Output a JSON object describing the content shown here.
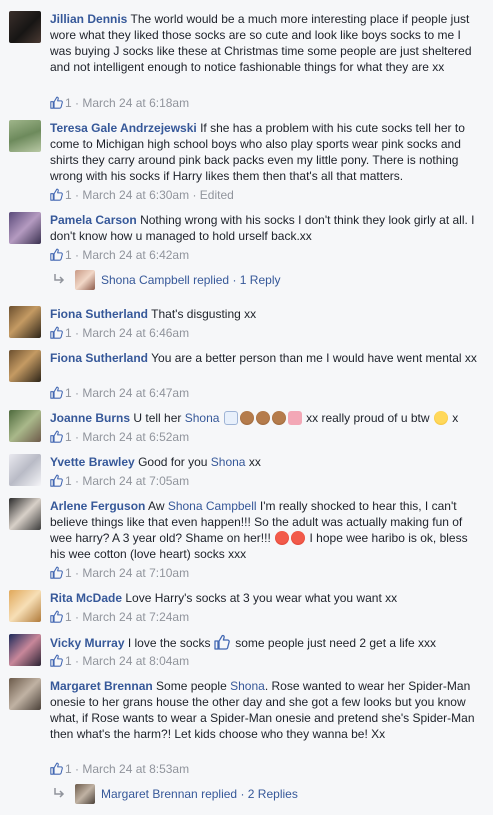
{
  "colors": {
    "link": "#365899",
    "meta": "#90949c",
    "text": "#1d2129",
    "background": "#f6f7f9"
  },
  "comments": [
    {
      "name": "Jillian Dennis",
      "text": "The world would be a much more interesting place if people just wore what they liked those socks are so cute and look like boys socks to me I was buying J socks like these at Christmas time some people are just sheltered and not intelligent enough to notice fashionable things for what they are xx",
      "likes": "1",
      "time": "March 24 at 6:18am"
    },
    {
      "name": "Teresa Gale Andrzejewski",
      "text": "If she has a problem with his cute socks tell her to come to Michigan high school boys who also play sports wear pink socks and shirts they carry around pink back packs even my little pony. There is nothing wrong with his socks if Harry likes them then that's all that matters.",
      "likes": "1",
      "time": "March 24 at 6:30am",
      "edited": "Edited"
    },
    {
      "name": "Pamela Carson",
      "text": "Nothing wrong with his socks I don't think they look girly at all. I don't know how u managed to hold urself back.xx",
      "likes": "1",
      "time": "March 24 at 6:42am",
      "reply": {
        "author": "Shona Campbell",
        "verb": "replied",
        "count": "1 Reply"
      }
    },
    {
      "name": "Fiona Sutherland",
      "text": "That's disgusting xx",
      "likes": "1",
      "time": "March 24 at 6:46am"
    },
    {
      "name": "Fiona Sutherland",
      "text": "You are a better person than me I would have went mental xx",
      "likes": "1",
      "time": "March 24 at 6:47am"
    },
    {
      "name": "Joanne Burns",
      "text_before": "U tell her",
      "tag": "Shona",
      "text_after": "xx really proud of u btw",
      "text_end": "x",
      "likes": "1",
      "time": "March 24 at 6:52am"
    },
    {
      "name": "Yvette Brawley",
      "text_before": "Good for you",
      "tag": "Shona",
      "text_after": "xx",
      "likes": "1",
      "time": "March 24 at 7:05am"
    },
    {
      "name": "Arlene Ferguson",
      "text_before": "Aw",
      "tag": "Shona Campbell",
      "text_after": "I'm really shocked to hear this, I can't believe things like that even happen!!! So the adult was actually making fun of wee harry? A 3 year old? Shame on her!!!",
      "text_end": "I hope wee haribo is ok, bless his wee cotton (love heart) socks xxx",
      "likes": "1",
      "time": "March 24 at 7:10am"
    },
    {
      "name": "Rita McDade",
      "text": "Love Harry's socks at 3 you wear what you want xx",
      "likes": "1",
      "time": "March 24 at 7:24am"
    },
    {
      "name": "Vicky Murray",
      "text_before": "I love the socks",
      "text_after": "some people just need 2 get a life xxx",
      "likes": "1",
      "time": "March 24 at 8:04am"
    },
    {
      "name": "Margaret Brennan",
      "text_before": "Some people",
      "tag": "Shona",
      "text_after": ". Rose wanted to wear her Spider-Man onesie to her grans house the other day and she got a few looks but you know what, if Rose wants to wear a Spider-Man onesie and pretend she's Spider-Man then what's the harm?! Let kids choose who they wanna be! Xx",
      "likes": "1",
      "time": "March 24 at 8:53am",
      "reply": {
        "author": "Margaret Brennan",
        "verb": "replied",
        "count": "2 Replies"
      }
    }
  ],
  "separator": "·"
}
